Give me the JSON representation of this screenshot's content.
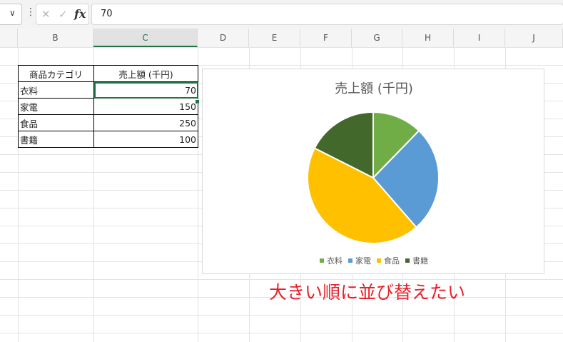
{
  "formula_bar": {
    "name_box_chevron": "∨",
    "more_dots": "⋮",
    "cancel_icon": "✕",
    "enter_icon": "✓",
    "fx_label": "fx",
    "formula_value": "70"
  },
  "columns": [
    "B",
    "C",
    "D",
    "E",
    "F",
    "G",
    "H",
    "I",
    "J"
  ],
  "selected_column": "C",
  "table": {
    "headers": [
      "商品カテゴリ",
      "売上額 (千円)"
    ],
    "rows": [
      {
        "category": "衣料",
        "value": "70"
      },
      {
        "category": "家電",
        "value": "150"
      },
      {
        "category": "食品",
        "value": "250"
      },
      {
        "category": "書籍",
        "value": "100"
      }
    ]
  },
  "chart_data": {
    "type": "pie",
    "title": "売上額 (千円)",
    "categories": [
      "衣料",
      "家電",
      "食品",
      "書籍"
    ],
    "values": [
      70,
      150,
      250,
      100
    ],
    "colors": [
      "#70ad47",
      "#5b9bd5",
      "#ffc000",
      "#43682b"
    ],
    "legend_position": "bottom"
  },
  "annotation": {
    "text": "大きい順に並び替えたい",
    "color": "#e8202a"
  }
}
